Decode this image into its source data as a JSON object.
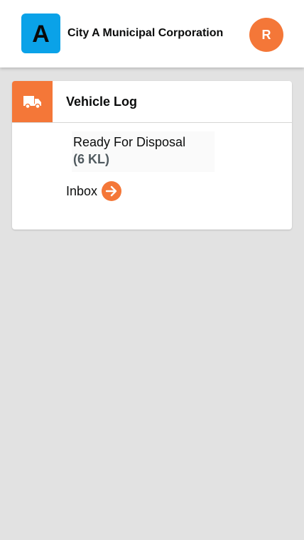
{
  "header": {
    "logo_letter": "A",
    "title": "City A Municipal Corporation",
    "avatar_initial": "R"
  },
  "card": {
    "icon": "truck-icon",
    "title": "Vehicle Log",
    "metric": {
      "label": "Ready For Disposal",
      "value": "(6 KL)"
    },
    "inbox": {
      "label": "Inbox",
      "icon": "arrow-right-icon"
    }
  },
  "colors": {
    "accent": "#f47738",
    "logo_bg": "#0aa2e8",
    "background": "#e2e2e2",
    "text": "#0b0c0c",
    "metric_value": "#505a5f"
  }
}
